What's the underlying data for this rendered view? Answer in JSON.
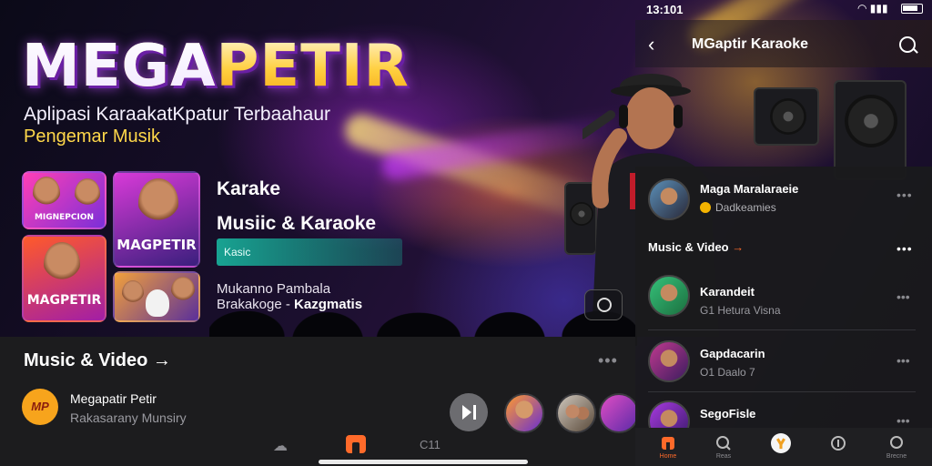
{
  "status_bar": {
    "time": "13:101"
  },
  "hero": {
    "logo_part1": "MEGA",
    "logo_part2": "PETIR",
    "tagline_line1": "Aplipasi KaraakatKpatur Terbaahaur",
    "tagline_line2": "Pengemar Musik",
    "covers": [
      {
        "caption": "MIGNEPCION"
      },
      {
        "caption": "MAGPETIR"
      },
      {
        "caption": "MAGPETIR"
      },
      {
        "caption": ""
      }
    ],
    "title_line1": "Karake",
    "title_line2": "Musiic & Karaoke",
    "badge": "Kasic",
    "subtitle_line1": "Mukanno Pambala",
    "subtitle_line2_a": "Brakakoge -",
    "subtitle_line2_b": "Kazgmatis"
  },
  "bottom_left": {
    "section_title": "Music & Video →",
    "now_playing_logo": "MP",
    "now_playing_title": "Megapatir Petir",
    "now_playing_subtitle": "Rakasarany Munsiry",
    "tab_label": "C11"
  },
  "right_panel": {
    "app_title": "MGaptir Karaoke",
    "artist_name": "Maga Maralaraeie",
    "artist_sub": "Dadkeamies",
    "section_title": "Music & Video",
    "section_arrow": "→",
    "list_items": [
      {
        "title": "Karandeit",
        "subtitle": "G1 Hetura Visna"
      },
      {
        "title": "Gapdacarin",
        "subtitle": "O1 Daalo 7"
      },
      {
        "title": "SegoFisle",
        "subtitle": ""
      }
    ],
    "nav": [
      {
        "label": "Home"
      },
      {
        "label": "Reas"
      },
      {
        "label": ""
      },
      {
        "label": ""
      },
      {
        "label": "Brecne"
      }
    ]
  },
  "colors": {
    "accent": "#ff6a2a",
    "logo_gold": "#ffcf3f",
    "badge_teal": "#18a392",
    "panel_bg": "#1c1c1e"
  }
}
